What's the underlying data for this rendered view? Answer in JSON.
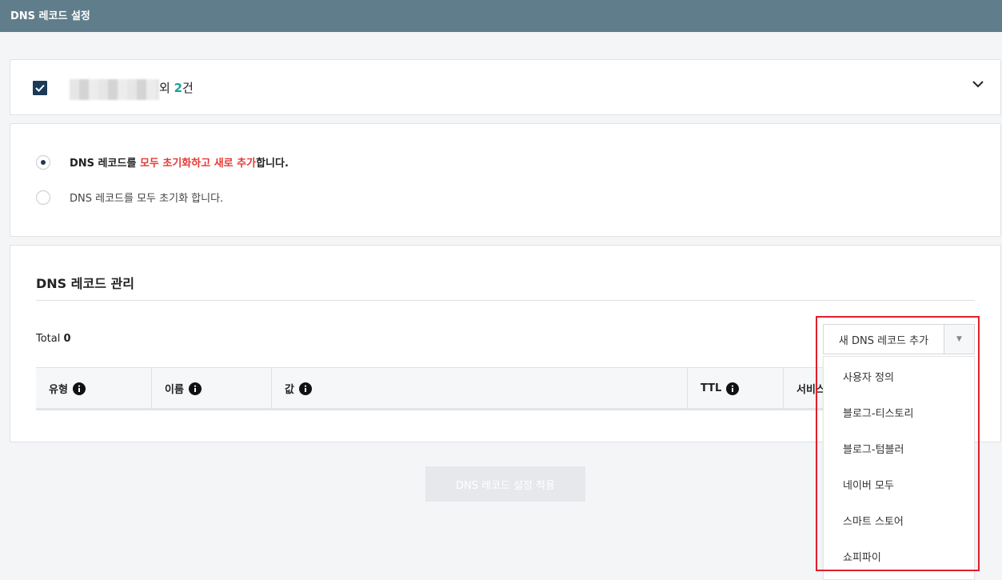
{
  "header": {
    "title": "DNS 레코드 설정"
  },
  "domain_panel": {
    "extra_prefix": "외 ",
    "extra_count": "2",
    "extra_suffix": "건"
  },
  "mode_options": [
    {
      "part1": "DNS 레코드를 ",
      "highlight": "모두 초기화하고 새로 추가",
      "part2": "합니다.",
      "selected": true
    },
    {
      "label": "DNS 레코드를 모두 초기화 합니다.",
      "selected": false
    }
  ],
  "records": {
    "title": "DNS 레코드 관리",
    "total_label": "Total",
    "total_count": "0",
    "columns": [
      "유형",
      "이름",
      "값",
      "TTL",
      "서비스"
    ]
  },
  "add_button": {
    "label": "새 DNS 레코드 추가"
  },
  "menu": {
    "items": [
      "사용자 정의",
      "블로그-티스토리",
      "블로그-텀블러",
      "네이버 모두",
      "스마트 스토어",
      "쇼피파이"
    ]
  },
  "apply_button": {
    "label": "DNS 레코드 설정 적용"
  },
  "colors": {
    "header_bg": "#607d8b",
    "accent_red": "#e53935",
    "count_teal": "#1aa29a",
    "check_navy": "#1b3a57"
  }
}
